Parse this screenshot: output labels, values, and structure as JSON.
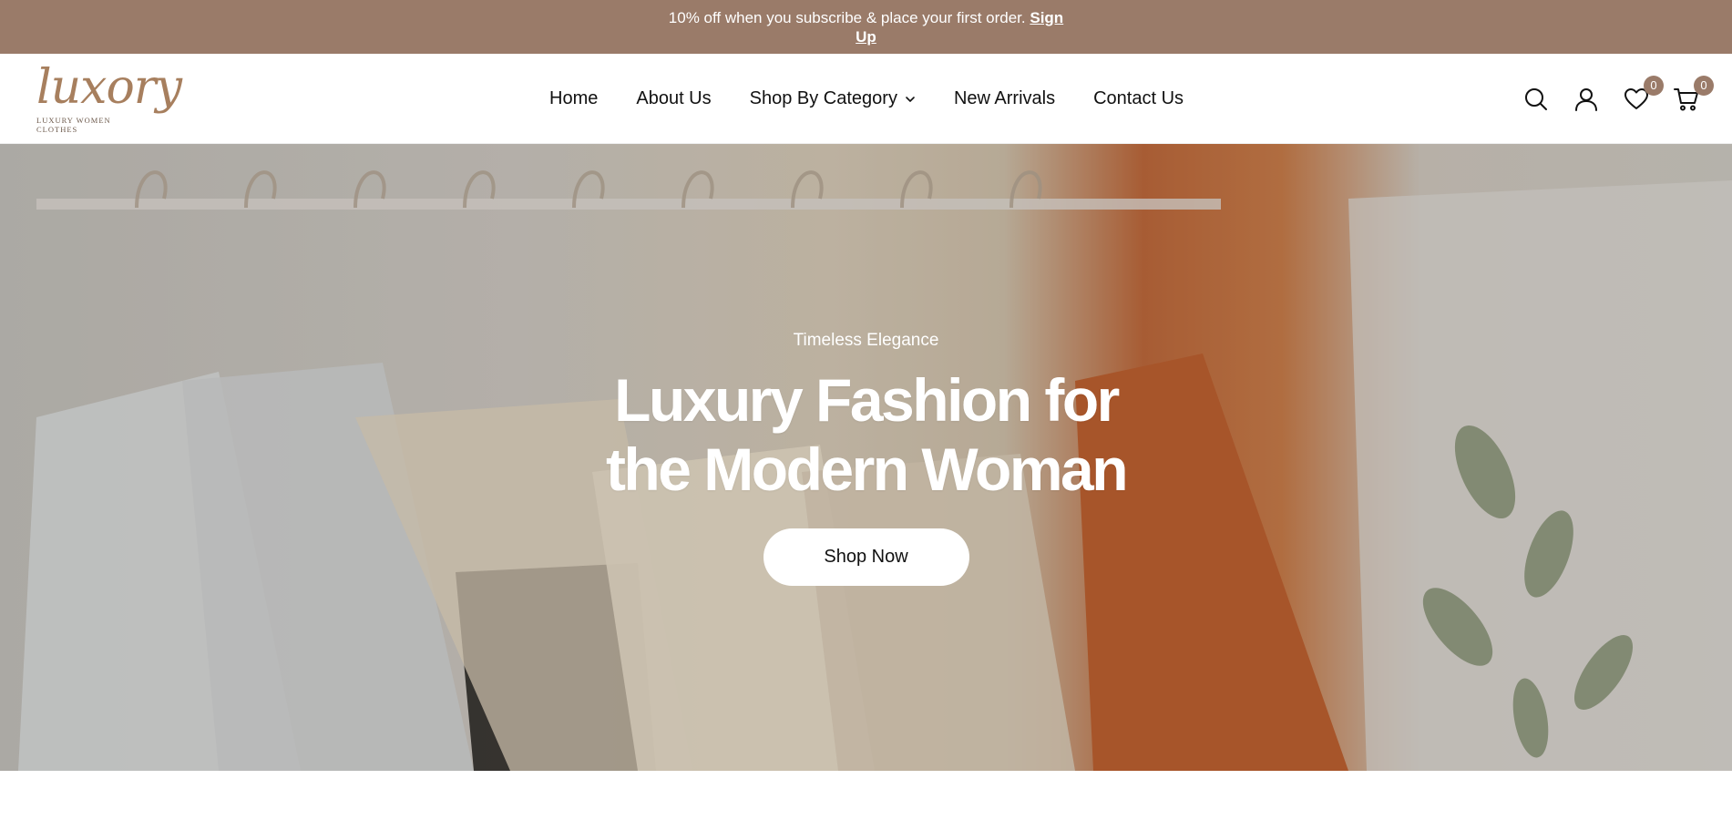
{
  "announcement": {
    "text": "10% off when you subscribe & place your first order.",
    "link_label": "Sign Up"
  },
  "header": {
    "logo": {
      "word": "luxory",
      "tagline": "LUXURY WOMEN CLOTHES"
    },
    "nav": [
      {
        "label": "Home"
      },
      {
        "label": "About Us"
      },
      {
        "label": "Shop By Category",
        "has_dropdown": true
      },
      {
        "label": "New Arrivals"
      },
      {
        "label": "Contact Us"
      }
    ],
    "icons": {
      "search": "search-icon",
      "account": "user-icon",
      "wishlist": "heart-icon",
      "cart": "cart-icon"
    },
    "wishlist_count": "0",
    "cart_count": "0"
  },
  "hero": {
    "eyebrow": "Timeless Elegance",
    "title_line1": "Luxury Fashion for",
    "title_line2": "the Modern Woman",
    "cta_label": "Shop Now"
  },
  "colors": {
    "accent": "#9a7b69",
    "logo": "#a77f5e",
    "text": "#111111"
  }
}
